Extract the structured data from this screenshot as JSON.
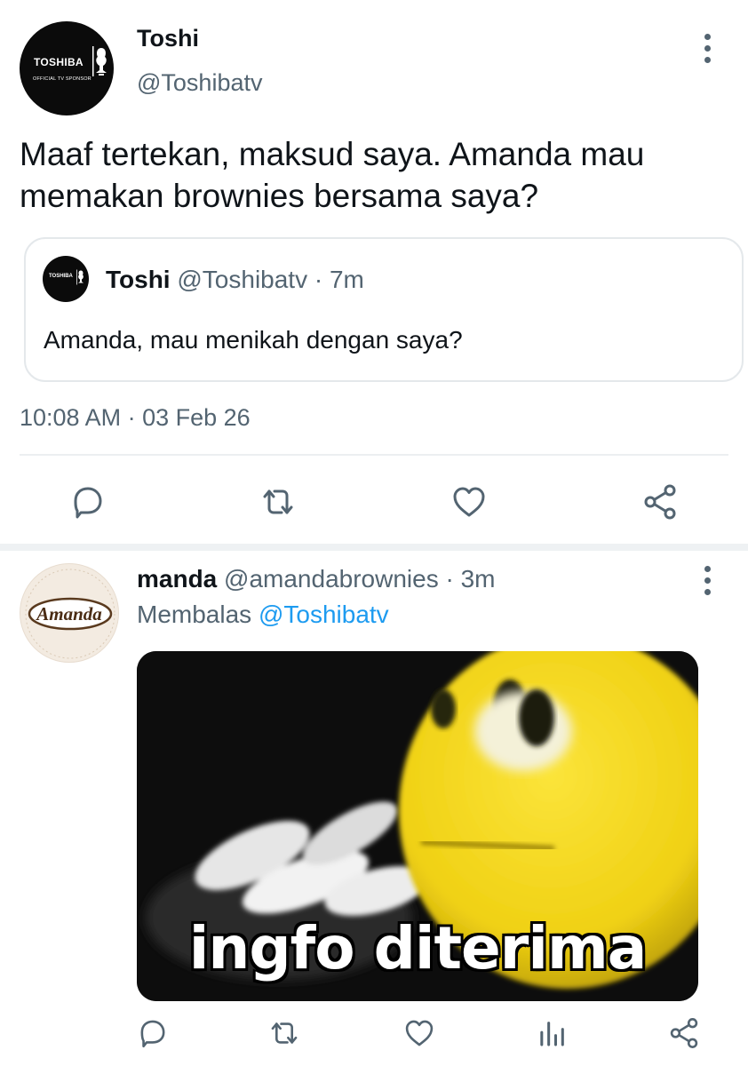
{
  "main_tweet": {
    "author_name": "Toshi",
    "author_handle": "@Toshibatv",
    "avatar": {
      "brand": "TOSHIBA",
      "tagline": "OFFICIAL TV SPONSOR",
      "trophy_label": "FIFA",
      "colors": {
        "background": "#0b0b0b",
        "text": "#ffffff"
      }
    },
    "text_line1": "Maaf tertekan, maksud saya. Amanda mau",
    "text_line2": "memakan brownies bersama saya?",
    "timestamp": "10:08 AM · 03 Feb 26",
    "quoted_tweet": {
      "author_name": "Toshi",
      "meta": "@Toshibatv · 7m",
      "text": "Amanda, mau menikah dengan saya?"
    },
    "actions": [
      "reply-icon",
      "retweet-icon",
      "like-icon",
      "share-icon"
    ]
  },
  "reply_tweet": {
    "author_name": "manda",
    "meta": "@amandabrownies · 3m",
    "replying_prefix": "Membalas",
    "replying_to": "@Toshibatv",
    "avatar": {
      "brand": "Amanda"
    },
    "meme_caption": "ingfo diterima",
    "actions": [
      "reply-icon",
      "retweet-icon",
      "like-icon",
      "analytics-icon",
      "share-icon"
    ]
  },
  "colors": {
    "text_primary": "#0f1419",
    "text_secondary": "#536471",
    "link": "#1d9bf0",
    "divider": "#eceff1",
    "emoji_yellow": "#f2d81a"
  }
}
